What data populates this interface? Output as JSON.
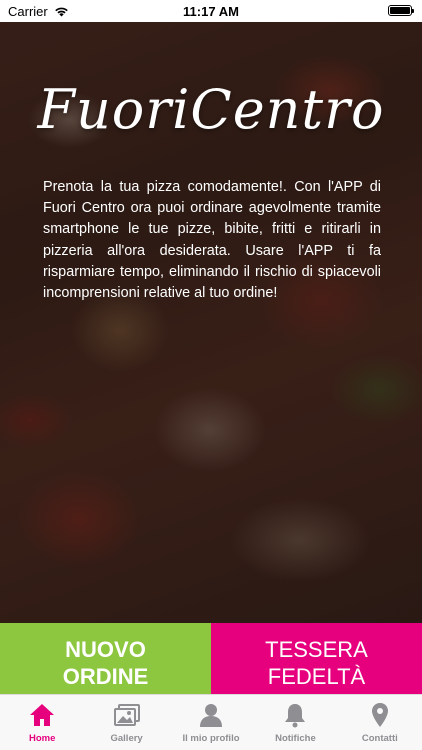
{
  "status_bar": {
    "carrier": "Carrier",
    "time": "11:17 AM"
  },
  "logo": {
    "text": "FuoriCentro"
  },
  "intro": {
    "text": "Prenota la tua pizza comodamente!. Con l'APP di Fuori Centro ora puoi ordinare agevolmente tramite smartphone le tue pizze, bibite, fritti e ritirarli in pizzeria all'ora desiderata. Usare l'APP ti fa risparmiare tempo, eliminando il rischio di spiacevoli incomprensioni relative al tuo ordine!"
  },
  "actions": {
    "order": {
      "line1": "NUOVO",
      "line2": "ORDINE",
      "color": "#8dc63f"
    },
    "card": {
      "line1": "TESSERA",
      "line2": "FEDELTÀ",
      "color": "#e6007e"
    }
  },
  "tabbar": {
    "active_color": "#e6007e",
    "items": [
      {
        "label": "Home",
        "icon": "home-icon"
      },
      {
        "label": "Gallery",
        "icon": "gallery-icon"
      },
      {
        "label": "Il mio profilo",
        "icon": "user-icon"
      },
      {
        "label": "Notifiche",
        "icon": "bell-icon"
      },
      {
        "label": "Contatti",
        "icon": "location-pin-icon"
      }
    ]
  }
}
